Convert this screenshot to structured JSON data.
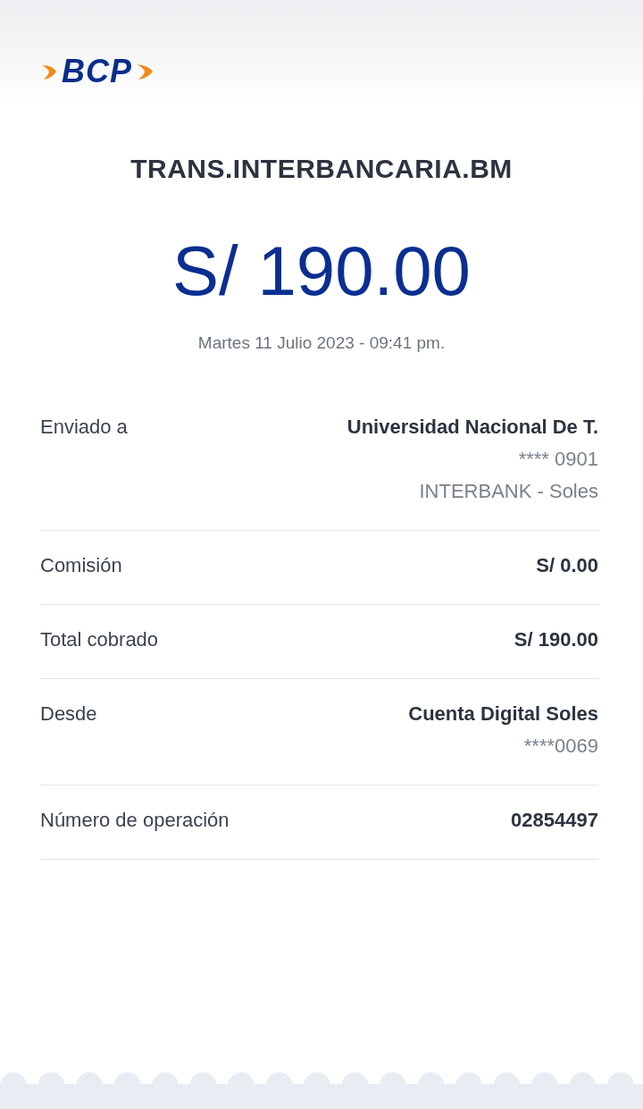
{
  "logo": {
    "text": "BCP"
  },
  "title": "TRANS.INTERBANCARIA.BM",
  "amount": "S/ 190.00",
  "date": "Martes 11 Julio 2023 - 09:41 pm.",
  "rows": [
    {
      "label": "Enviado a",
      "values": [
        {
          "text": "Universidad Nacional De T.",
          "bold": true
        },
        {
          "text": "**** 0901",
          "bold": false
        },
        {
          "text": "INTERBANK - Soles",
          "bold": false
        }
      ]
    },
    {
      "label": "Comisión",
      "values": [
        {
          "text": "S/ 0.00",
          "bold": true
        }
      ]
    },
    {
      "label": "Total cobrado",
      "values": [
        {
          "text": "S/ 190.00",
          "bold": true
        }
      ]
    },
    {
      "label": "Desde",
      "values": [
        {
          "text": "Cuenta Digital Soles",
          "bold": true
        },
        {
          "text": "****0069",
          "bold": false
        }
      ]
    },
    {
      "label": "Número de operación",
      "values": [
        {
          "text": "02854497",
          "bold": true
        }
      ]
    }
  ]
}
